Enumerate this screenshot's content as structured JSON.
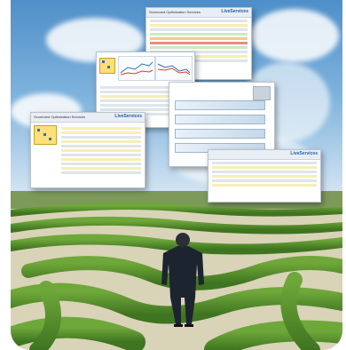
{
  "scene": {
    "description_free": true,
    "shots": [
      {
        "title": "Scorecard Optimization Services",
        "brand": "LiveServices"
      },
      {
        "title": "",
        "brand": ""
      },
      {
        "title": "Scorecard Optimization Services",
        "brand": "LiveServices"
      },
      {
        "title": "",
        "brand": ""
      },
      {
        "title": "",
        "brand": "LiveServices"
      }
    ]
  },
  "colors": {
    "sky_top": "#4f8fc9",
    "hedge": "#5f9a2c",
    "path": "#d9d3b8",
    "accent": "#1d5fa8"
  }
}
